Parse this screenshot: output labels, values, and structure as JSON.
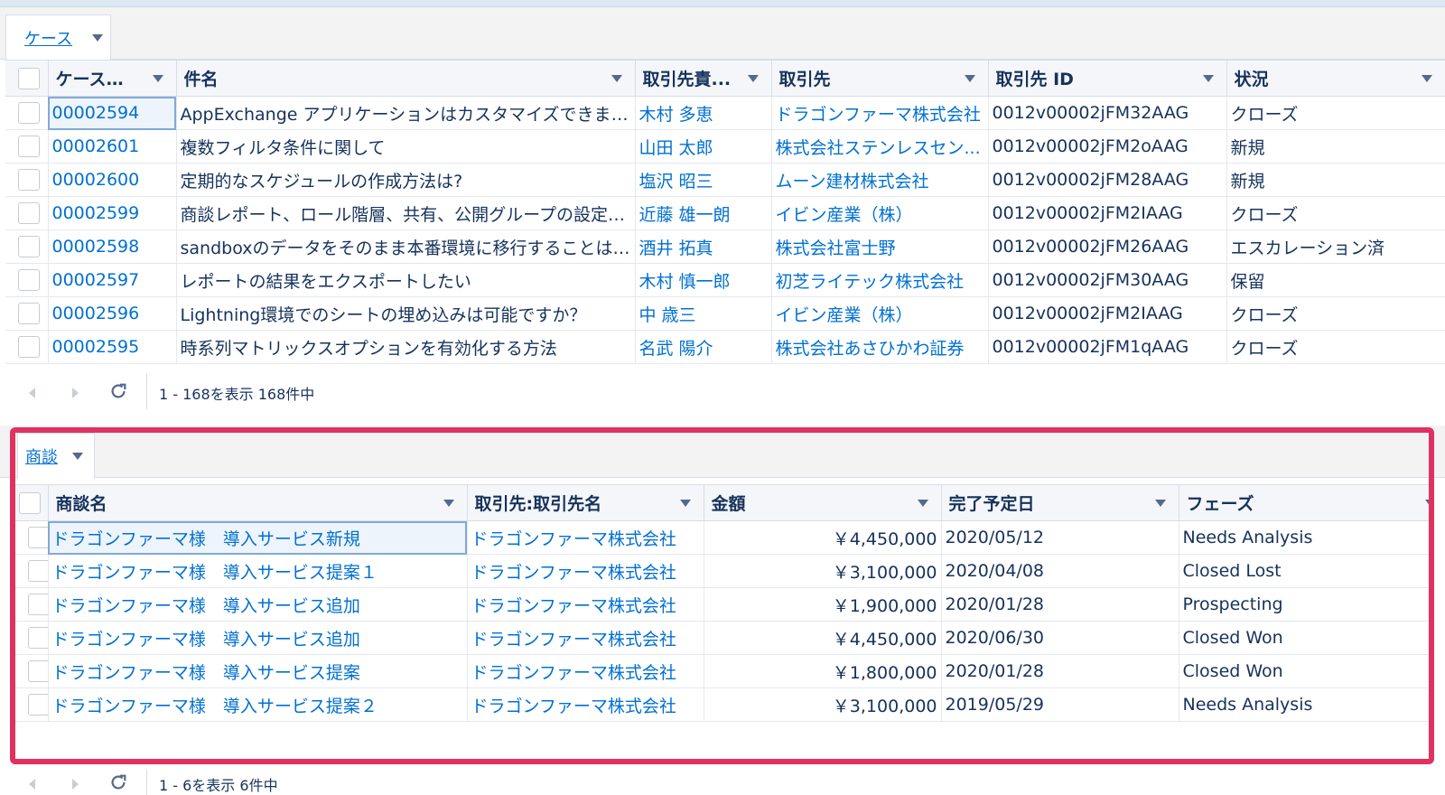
{
  "cases_panel": {
    "tab_label": "ケース",
    "columns": [
      "ケース番号",
      "件名",
      "取引先責...",
      "取引先",
      "取引先 ID",
      "状況"
    ],
    "rows": [
      {
        "number": "00002594",
        "subject": "AppExchange アプリケーションはカスタマイズできますか",
        "contact": "木村 多恵",
        "account": "ドラゴンファーマ株式会社",
        "account_id": "0012v00002jFM32AAG",
        "status": "クローズ"
      },
      {
        "number": "00002601",
        "subject": "複数フィルタ条件に関して",
        "contact": "山田 太郎",
        "account": "株式会社ステンレスセン...",
        "account_id": "0012v00002jFM2oAAG",
        "status": "新規"
      },
      {
        "number": "00002600",
        "subject": "定期的なスケジュールの作成方法は?",
        "contact": "塩沢 昭三",
        "account": "ムーン建材株式会社",
        "account_id": "0012v00002jFM28AAG",
        "status": "新規"
      },
      {
        "number": "00002599",
        "subject": "商談レポート、ロール階層、共有、公開グループの設定に...",
        "contact": "近藤 雄一朗",
        "account": "イビン産業（株）",
        "account_id": "0012v00002jFM2IAAG",
        "status": "クローズ"
      },
      {
        "number": "00002598",
        "subject": "sandboxのデータをそのまま本番環境に移行することは可...",
        "contact": "酒井 拓真",
        "account": "株式会社富士野",
        "account_id": "0012v00002jFM26AAG",
        "status": "エスカレーション済"
      },
      {
        "number": "00002597",
        "subject": "レポートの結果をエクスポートしたい",
        "contact": "木村 慎一郎",
        "account": "初芝ライテック株式会社",
        "account_id": "0012v00002jFM30AAG",
        "status": "保留"
      },
      {
        "number": "00002596",
        "subject": "Lightning環境でのシートの埋め込みは可能ですか？",
        "contact": "中 歳三",
        "account": "イビン産業（株）",
        "account_id": "0012v00002jFM2IAAG",
        "status": "クローズ"
      },
      {
        "number": "00002595",
        "subject": "時系列マトリックスオプションを有効化する方法",
        "contact": "名武 陽介",
        "account": "株式会社あさひかわ証券",
        "account_id": "0012v00002jFM1qAAG",
        "status": "クローズ"
      }
    ],
    "footer_count": "1 - 168を表示 168件中"
  },
  "opps_panel": {
    "tab_label": "商談",
    "columns": [
      "商談名",
      "取引先:取引先名",
      "金額",
      "完了予定日",
      "フェーズ"
    ],
    "rows": [
      {
        "name": "ドラゴンファーマ様　導入サービス新規",
        "account": "ドラゴンファーマ株式会社",
        "amount": "￥4,450,000",
        "close_date": "2020/05/12",
        "stage": "Needs Analysis"
      },
      {
        "name": "ドラゴンファーマ様　導入サービス提案１",
        "account": "ドラゴンファーマ株式会社",
        "amount": "￥3,100,000",
        "close_date": "2020/04/08",
        "stage": "Closed Lost"
      },
      {
        "name": "ドラゴンファーマ様　導入サービス追加",
        "account": "ドラゴンファーマ株式会社",
        "amount": "￥1,900,000",
        "close_date": "2020/01/28",
        "stage": "Prospecting"
      },
      {
        "name": "ドラゴンファーマ様　導入サービス追加",
        "account": "ドラゴンファーマ株式会社",
        "amount": "￥4,450,000",
        "close_date": "2020/06/30",
        "stage": "Closed Won"
      },
      {
        "name": "ドラゴンファーマ様　導入サービス提案",
        "account": "ドラゴンファーマ株式会社",
        "amount": "￥1,800,000",
        "close_date": "2020/01/28",
        "stage": "Closed Won"
      },
      {
        "name": "ドラゴンファーマ様　導入サービス提案２",
        "account": "ドラゴンファーマ株式会社",
        "amount": "￥3,100,000",
        "close_date": "2019/05/29",
        "stage": "Needs Analysis"
      }
    ],
    "footer_count": "1 - 6を表示 6件中"
  },
  "colors": {
    "link": "#0070d2",
    "highlight_border": "#e0325f",
    "header_bg": "#f4f6f9"
  },
  "icons": [
    "chevron-down-icon",
    "prev-page-icon",
    "next-page-icon",
    "refresh-icon"
  ]
}
